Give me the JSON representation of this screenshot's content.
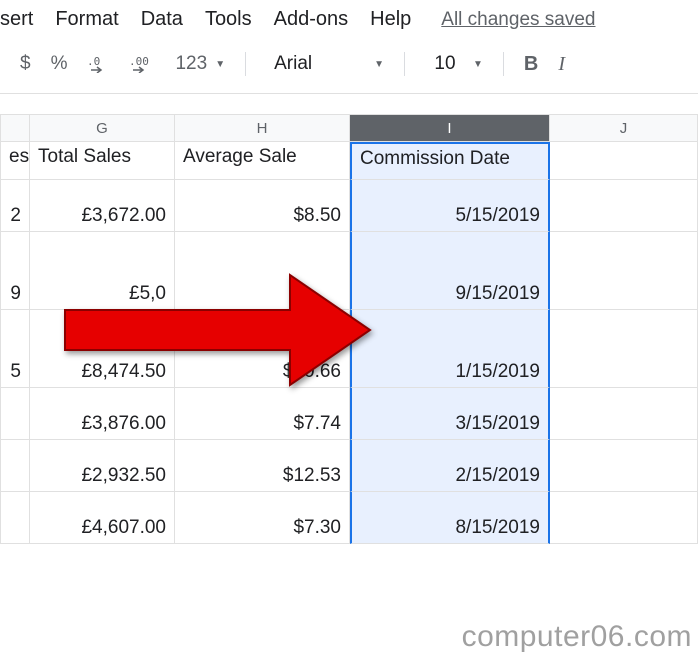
{
  "menu": {
    "insert": "sert",
    "format": "Format",
    "data": "Data",
    "tools": "Tools",
    "addons": "Add-ons",
    "help": "Help",
    "changes_saved": "All changes saved"
  },
  "toolbar": {
    "currency": "$",
    "percent": "%",
    "dec_decrease": ".0",
    "dec_increase": ".00",
    "more_formats": "123",
    "font_name": "Arial",
    "font_size": "10",
    "bold": "B",
    "italic": "I"
  },
  "columns": {
    "f": "",
    "g": "G",
    "h": "H",
    "i": "I",
    "j": "J"
  },
  "headers": {
    "f": "es",
    "g": "Total Sales",
    "h": "Average Sale",
    "i": "Commission Date",
    "j": ""
  },
  "rows": [
    {
      "f": "2",
      "g": "£3,672.00",
      "h": "$8.50",
      "i": "5/15/2019",
      "tall": false
    },
    {
      "f": "9",
      "g": "£5,0",
      "h": "",
      "i": "9/15/2019",
      "tall": true
    },
    {
      "f": "5",
      "g": "£8,474.50",
      "h": "$10.66",
      "i": "1/15/2019",
      "tall": true
    },
    {
      "f": "",
      "g": "£3,876.00",
      "h": "$7.74",
      "i": "3/15/2019",
      "tall": false
    },
    {
      "f": "",
      "g": "£2,932.50",
      "h": "$12.53",
      "i": "2/15/2019",
      "tall": false
    },
    {
      "f": "",
      "g": "£4,607.00",
      "h": "$7.30",
      "i": "8/15/2019",
      "tall": false
    }
  ],
  "watermark": "computer06.com"
}
